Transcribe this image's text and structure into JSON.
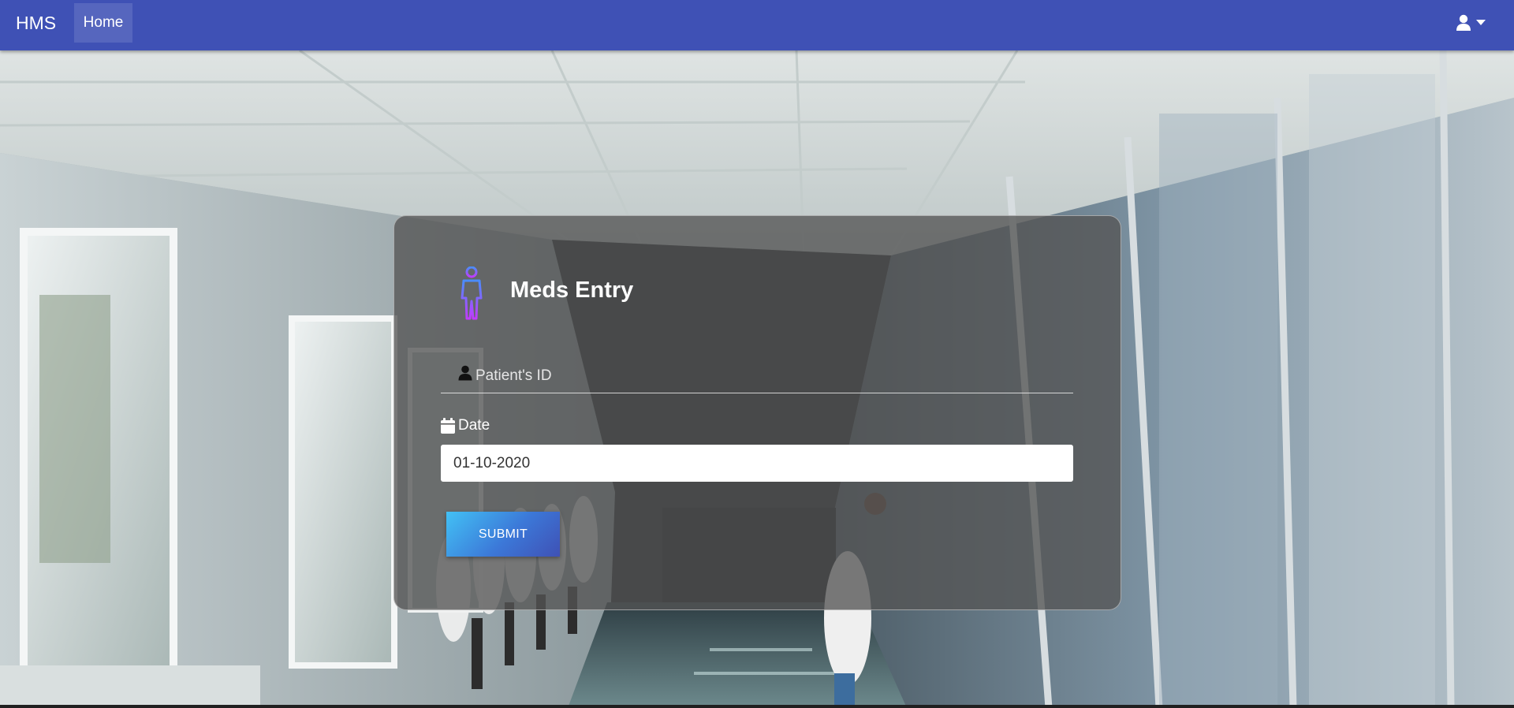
{
  "navbar": {
    "brand": "HMS",
    "home_link": "Home",
    "user_icon": "user-icon",
    "dropdown_icon": "caret-down-icon",
    "color": "#3f51b5"
  },
  "form": {
    "icon": "human-body-icon",
    "title": "Meds Entry",
    "patient_id": {
      "icon": "user-icon",
      "placeholder": "Patient's ID",
      "value": ""
    },
    "date": {
      "icon": "calendar-icon",
      "label": "Date",
      "value": "01-10-2020"
    },
    "submit_label": "SUBMIT"
  },
  "colors": {
    "accent": "#3f51b5",
    "button_gradient_start": "#42c1f5",
    "button_gradient_end": "#3f51b5"
  }
}
